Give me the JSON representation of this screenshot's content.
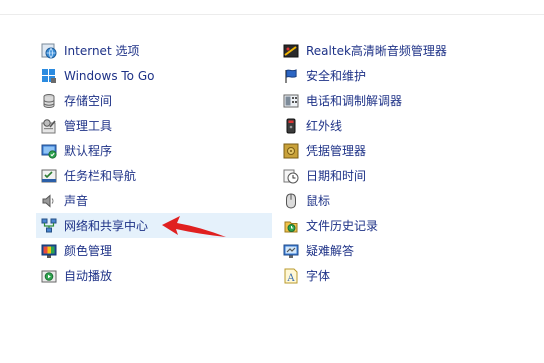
{
  "left_items": [
    {
      "label": "Internet 选项",
      "icon": "globe-icon"
    },
    {
      "label": "Windows To Go",
      "icon": "usb-drive-icon"
    },
    {
      "label": "存储空间",
      "icon": "storage-icon"
    },
    {
      "label": "管理工具",
      "icon": "admin-tools-icon"
    },
    {
      "label": "默认程序",
      "icon": "default-programs-icon"
    },
    {
      "label": "任务栏和导航",
      "icon": "taskbar-icon"
    },
    {
      "label": "声音",
      "icon": "speaker-icon"
    },
    {
      "label": "网络和共享中心",
      "icon": "network-icon"
    },
    {
      "label": "颜色管理",
      "icon": "color-monitor-icon"
    },
    {
      "label": "自动播放",
      "icon": "autoplay-icon"
    }
  ],
  "right_items": [
    {
      "label": "Realtek高清晰音频管理器",
      "icon": "realtek-audio-icon"
    },
    {
      "label": "安全和维护",
      "icon": "flag-icon"
    },
    {
      "label": "电话和调制解调器",
      "icon": "phone-modem-icon"
    },
    {
      "label": "红外线",
      "icon": "infrared-icon"
    },
    {
      "label": "凭据管理器",
      "icon": "credential-safe-icon"
    },
    {
      "label": "日期和时间",
      "icon": "clock-icon"
    },
    {
      "label": "鼠标",
      "icon": "mouse-icon"
    },
    {
      "label": "文件历史记录",
      "icon": "file-history-icon"
    },
    {
      "label": "疑难解答",
      "icon": "troubleshoot-icon"
    },
    {
      "label": "字体",
      "icon": "font-icon"
    }
  ],
  "selected_item": "网络和共享中心",
  "colors": {
    "link_text": "#1e3287",
    "selection": "#e5f1fb",
    "annotation_arrow": "#e02020"
  }
}
